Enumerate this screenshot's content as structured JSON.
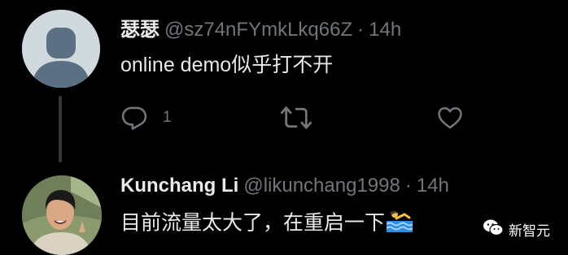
{
  "tweets": [
    {
      "name": "瑟瑟",
      "handle": "@sz74nFYmkLkq66Z",
      "dot": "·",
      "time": "14h",
      "text": "online demo似乎打不开",
      "reply_count": "1",
      "avatar_icon": "default-profile-icon"
    },
    {
      "name": "Kunchang Li",
      "handle": "@likunchang1998",
      "dot": "·",
      "time": "14h",
      "text": "目前流量太大了，在重启一下",
      "emoji": "person-swimming-emoji",
      "avatar_icon": "profile-photo"
    }
  ],
  "actions": {
    "reply_icon": "reply-icon",
    "retweet_icon": "retweet-icon",
    "like_icon": "heart-icon"
  },
  "watermark": {
    "text": "新智元",
    "icon": "wechat-icon"
  },
  "colors": {
    "background": "#000000",
    "text": "#e7e9ea",
    "secondary": "#71767b",
    "thread_line": "#333639"
  }
}
